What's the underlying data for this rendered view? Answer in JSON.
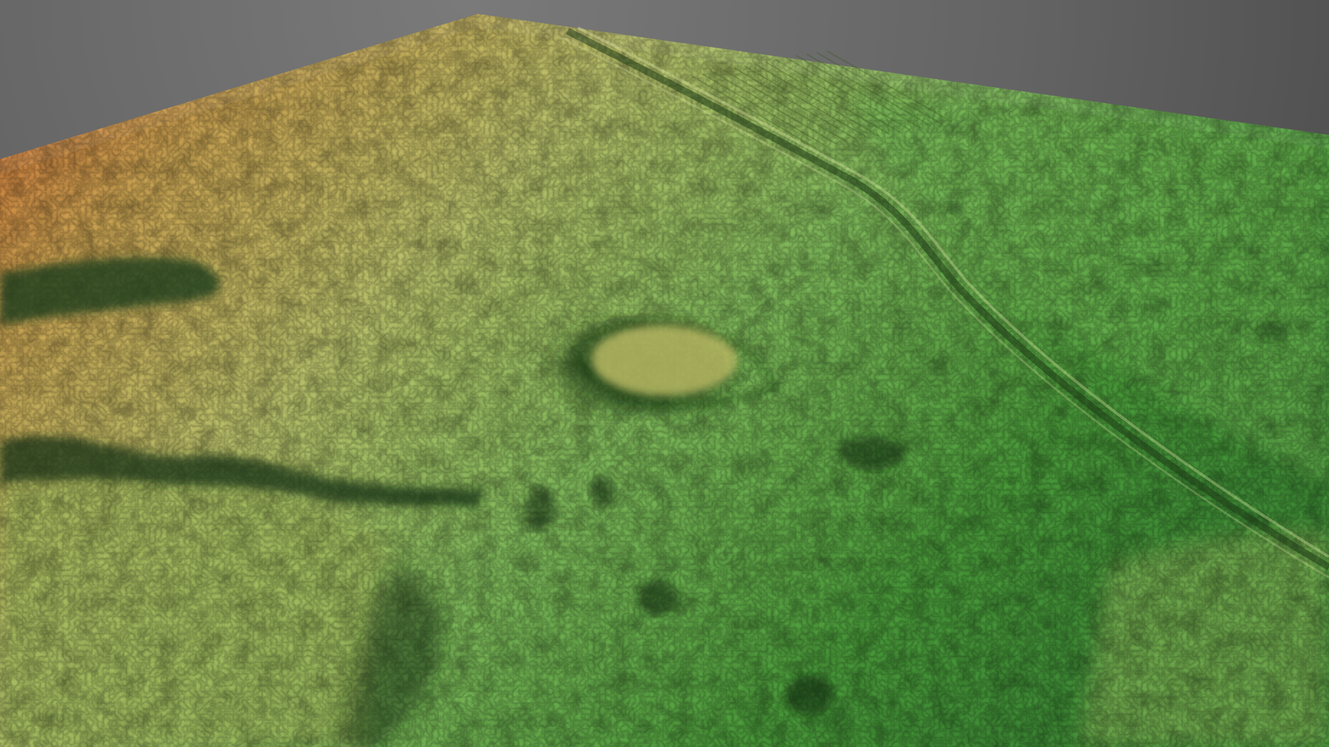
{
  "scene": {
    "background_color": "#6b6b6b",
    "elevation_ramp": {
      "high": "#d0652e",
      "mid_high": "#c9a352",
      "mid": "#b9c06a",
      "mid_low": "#7fb85a",
      "low": "#4a9a3a",
      "lowest": "#2f6e2a"
    },
    "features": [
      {
        "name": "road",
        "label": ""
      },
      {
        "name": "mound",
        "label": ""
      },
      {
        "name": "plowed-field",
        "label": ""
      },
      {
        "name": "ridge",
        "label": ""
      },
      {
        "name": "depression",
        "label": ""
      }
    ]
  }
}
